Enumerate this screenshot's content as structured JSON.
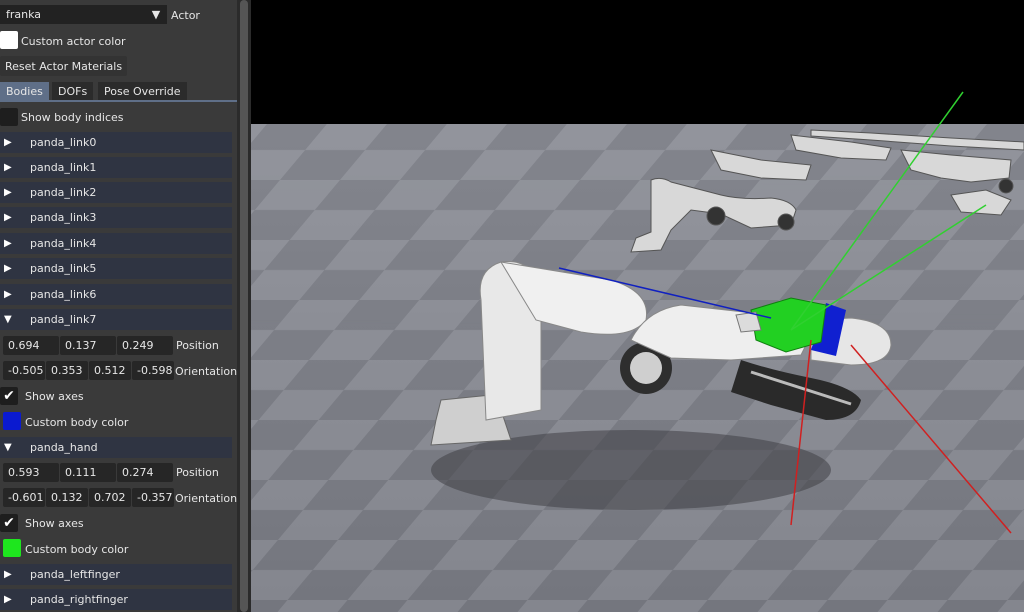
{
  "actor": {
    "selected": "franka",
    "label": "Actor"
  },
  "custom_actor_color": {
    "label": "Custom actor color",
    "color": "#ffffff"
  },
  "reset_button": "Reset Actor Materials",
  "tabs": [
    {
      "label": "Bodies",
      "active": true
    },
    {
      "label": "DOFs",
      "active": false
    },
    {
      "label": "Pose Override",
      "active": false
    }
  ],
  "show_body_indices": {
    "label": "Show body indices",
    "checked": false
  },
  "bodies": [
    {
      "name": "panda_link0",
      "expanded": false
    },
    {
      "name": "panda_link1",
      "expanded": false
    },
    {
      "name": "panda_link2",
      "expanded": false
    },
    {
      "name": "panda_link3",
      "expanded": false
    },
    {
      "name": "panda_link4",
      "expanded": false
    },
    {
      "name": "panda_link5",
      "expanded": false
    },
    {
      "name": "panda_link6",
      "expanded": false
    },
    {
      "name": "panda_link7",
      "expanded": true,
      "position": [
        "0.694",
        "0.137",
        "0.249"
      ],
      "position_label": "Position",
      "orientation": [
        "-0.505",
        "0.353",
        "0.512",
        "-0.598"
      ],
      "orientation_label": "Orientation",
      "show_axes": "Show axes",
      "custom_color_label": "Custom body color",
      "color": "#0a1ad0"
    },
    {
      "name": "panda_hand",
      "expanded": true,
      "position": [
        "0.593",
        "0.111",
        "0.274"
      ],
      "position_label": "Position",
      "orientation": [
        "-0.601",
        "0.132",
        "0.702",
        "-0.357"
      ],
      "orientation_label": "Orientation",
      "show_axes": "Show axes",
      "custom_color_label": "Custom body color",
      "color": "#1ee61e"
    },
    {
      "name": "panda_leftfinger",
      "expanded": false
    },
    {
      "name": "panda_rightfinger",
      "expanded": false
    }
  ],
  "icons": {
    "expand": "triangle-right-icon",
    "collapse": "triangle-down-icon",
    "dropdown": "triangle-down-icon",
    "check": "checkmark-icon"
  },
  "colors": {
    "panel_bg": "#3a3a3a",
    "tree_node_bg": "#2f3442",
    "tab_active": "#5f6f88",
    "floor_light": "#8a8c94",
    "floor_dark": "#6e7078"
  }
}
